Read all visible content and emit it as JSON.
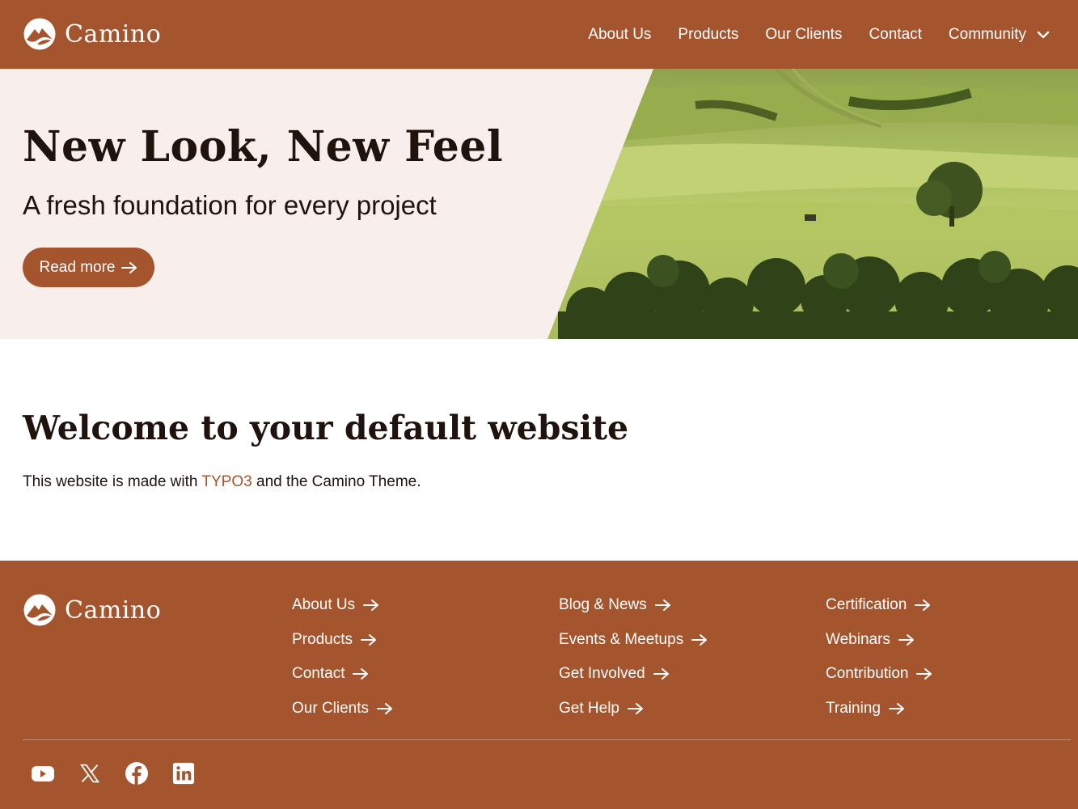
{
  "brand": {
    "name": "Camino"
  },
  "nav": {
    "items": [
      {
        "label": "About Us"
      },
      {
        "label": "Products"
      },
      {
        "label": "Our Clients"
      },
      {
        "label": "Contact"
      }
    ],
    "dropdown": {
      "label": "Community",
      "icon": "chevron-down-icon"
    }
  },
  "hero": {
    "title": "New Look, New Feel",
    "subtitle": "A fresh foundation for every project",
    "button_label": "Read more",
    "image": "landscape-fields-trees"
  },
  "main": {
    "title": "Welcome to your default website",
    "text_before": "This website is made with ",
    "link_text": "TYPO3",
    "text_after": " and the Camino Theme."
  },
  "footer": {
    "brand": "Camino",
    "columns": [
      {
        "links": [
          "About Us",
          "Products",
          "Contact",
          "Our Clients"
        ]
      },
      {
        "links": [
          "Blog & News",
          "Events & Meetups",
          "Get Involved",
          "Get Help"
        ]
      },
      {
        "links": [
          "Certification",
          "Webinars",
          "Contribution",
          "Training"
        ]
      }
    ],
    "socials": [
      "youtube-icon",
      "x-icon",
      "facebook-icon",
      "linkedin-icon"
    ]
  },
  "colors": {
    "accent": "#a5552e",
    "hero_bg": "#f8efec",
    "text": "#20120c"
  }
}
